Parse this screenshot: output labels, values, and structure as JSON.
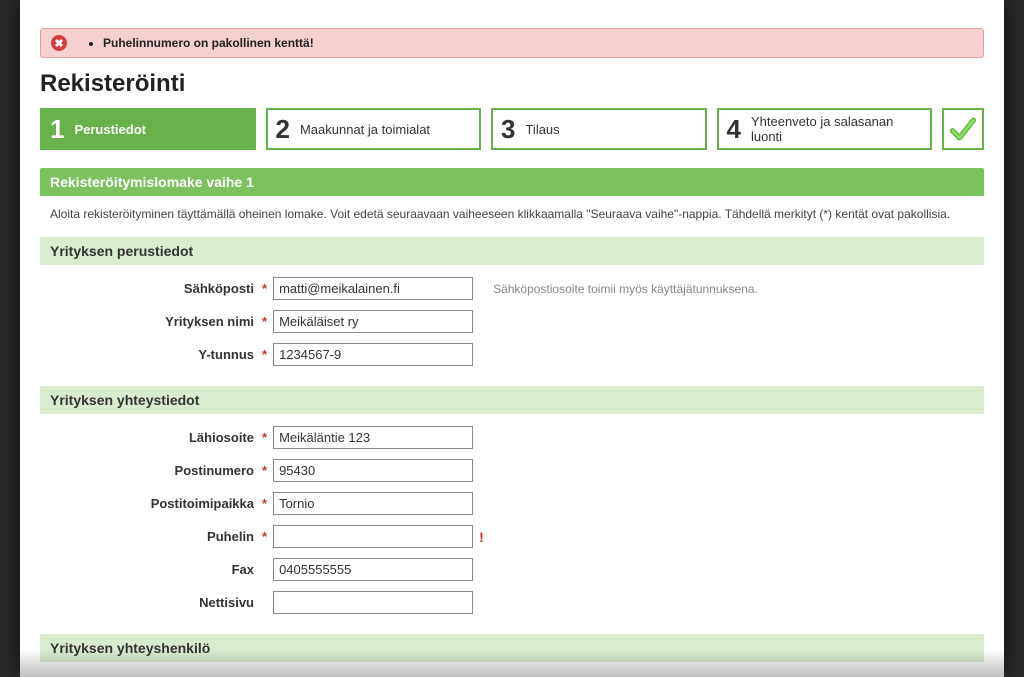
{
  "topnav": {
    "item1": "",
    "item2": ""
  },
  "error": {
    "message": "Puhelinnumero on pakollinen kenttä!"
  },
  "page_title": "Rekisteröinti",
  "steps": {
    "s1": {
      "num": "1",
      "label": "Perustiedot"
    },
    "s2": {
      "num": "2",
      "label": "Maakunnat ja toimialat"
    },
    "s3": {
      "num": "3",
      "label": "Tilaus"
    },
    "s4": {
      "num": "4",
      "label": "Yhteenveto ja salasanan luonti"
    }
  },
  "section": {
    "stage_title": "Rekisteröitymislomake vaihe 1",
    "intro": "Aloita rekisteröityminen täyttämällä oheinen lomake. Voit edetä seuraavaan vaiheeseen klikkaamalla \"Seuraava vaihe\"-nappia. Tähdellä merkityt (*) kentät ovat pakollisia.",
    "basic_title": "Yrityksen perustiedot",
    "contact_title": "Yrityksen yhteystiedot",
    "person_title": "Yrityksen yhteyshenkilö"
  },
  "labels": {
    "email": "Sähköposti",
    "company": "Yrityksen nimi",
    "businessid": "Y-tunnus",
    "street": "Lähiosoite",
    "zip": "Postinumero",
    "city": "Postitoimipaikka",
    "phone": "Puhelin",
    "fax": "Fax",
    "website": "Nettisivu",
    "req": "*",
    "warn": "!"
  },
  "values": {
    "email": "matti@meikalainen.fi",
    "company": "Meikäläiset ry",
    "businessid": "1234567-9",
    "street": "Meikäläntie 123",
    "zip": "95430",
    "city": "Tornio",
    "phone": "",
    "fax": "0405555555",
    "website": ""
  },
  "hints": {
    "email": "Sähköpostiosoite toimii myös käyttäjätunnuksena."
  }
}
